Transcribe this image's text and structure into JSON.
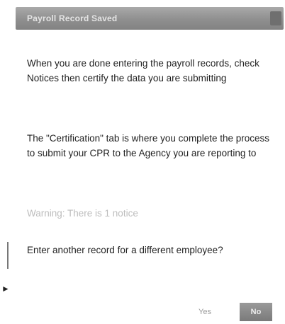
{
  "dialog": {
    "title": "Payroll Record Saved",
    "paragraphs": {
      "p1": "When you are done entering the payroll records, check Notices then certify the data you are submitting",
      "p2": "The \"Certification\" tab is where you complete the process to submit your CPR to the Agency you are reporting to",
      "warning": "Warning: There is 1 notice",
      "question": "Enter another record for a different employee?"
    },
    "buttons": {
      "yes": "Yes",
      "no": "No"
    }
  },
  "icons": {
    "close": "close-icon",
    "cursor": "mouse-cursor-icon"
  },
  "colors": {
    "titlebar": "#8f8f8f",
    "no_button": "#8a8a8a",
    "warning_text": "#bdbdbd"
  }
}
